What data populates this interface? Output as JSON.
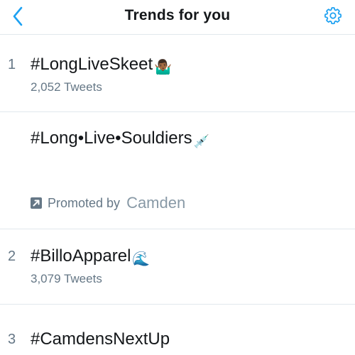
{
  "header": {
    "title": "Trends for you",
    "back_icon": "chevron-left-icon",
    "settings_icon": "gear-icon",
    "accent_color": "#1da1f2"
  },
  "trends": [
    {
      "rank": "1",
      "hashtag": "#LongLiveSkeet",
      "emoji": "🤷🏾‍♂️",
      "count": "2,052 Tweets"
    },
    {
      "rank": "",
      "hashtag": "#Long•Live•Souldiers",
      "emoji": "💉",
      "promoted_label": "Promoted by",
      "promoted_by": "Camden",
      "promoted_icon": "promoted-arrow-icon"
    },
    {
      "rank": "2",
      "hashtag": "#BilloApparel",
      "emoji": "🌊",
      "count": "3,079 Tweets"
    },
    {
      "rank": "3",
      "hashtag": "#CamdensNextUp"
    }
  ]
}
